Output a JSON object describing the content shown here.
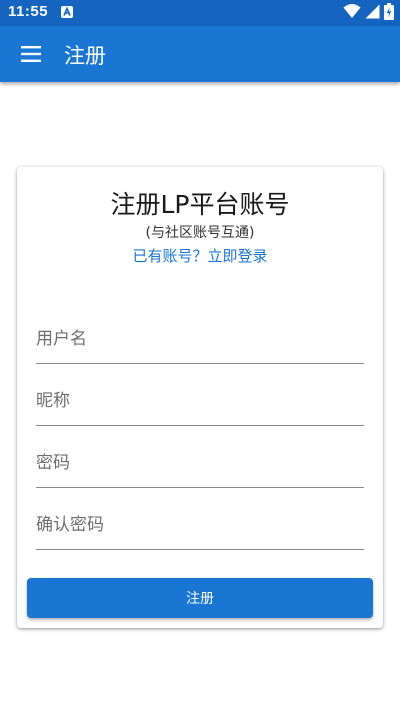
{
  "status_bar": {
    "time": "11:55",
    "background": "#1565c0",
    "icons": [
      "notification-a-icon",
      "wifi-icon",
      "signal-icon",
      "battery-charging-icon"
    ]
  },
  "app_bar": {
    "title": "注册",
    "background": "#1976d2",
    "menu_icon": "menu-icon"
  },
  "register_card": {
    "title": "注册LP平台账号",
    "subtitle": "(与社区账号互通)",
    "login_link": "已有账号？立即登录",
    "fields": [
      {
        "name": "username",
        "placeholder": "用户名",
        "value": ""
      },
      {
        "name": "nickname",
        "placeholder": "昵称",
        "value": ""
      },
      {
        "name": "password",
        "placeholder": "密码",
        "value": ""
      },
      {
        "name": "confirm_password",
        "placeholder": "确认密码",
        "value": ""
      }
    ],
    "submit_label": "注册",
    "accent": "#1976d2"
  }
}
